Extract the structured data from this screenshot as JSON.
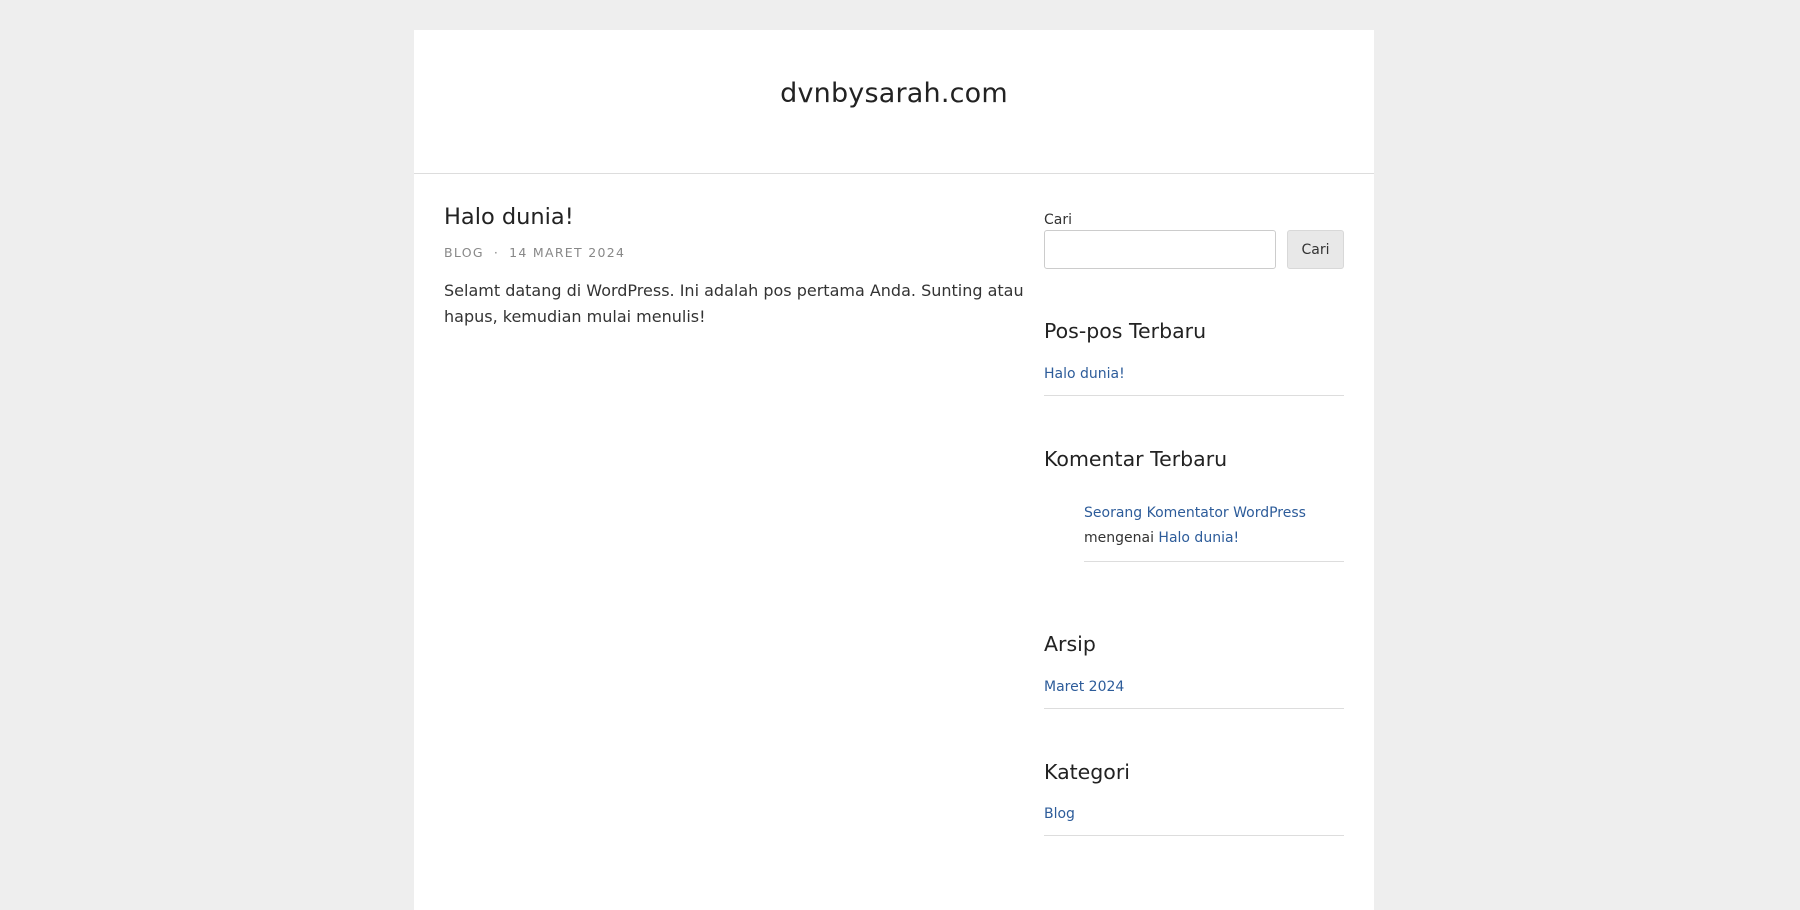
{
  "site": {
    "title": "dvnbysarah.com"
  },
  "post": {
    "title": "Halo dunia!",
    "category": "BLOG",
    "separator": "·",
    "date": "14 MARET 2024",
    "body": "Selamt datang di WordPress. Ini adalah pos pertama Anda. Sunting atau hapus, kemudian mulai menulis!"
  },
  "sidebar": {
    "search": {
      "label": "Cari",
      "value": "",
      "button_label": "Cari"
    },
    "recent_posts": {
      "title": "Pos-pos Terbaru",
      "items": [
        "Halo dunia!"
      ]
    },
    "recent_comments": {
      "title": "Komentar Terbaru",
      "items": [
        {
          "author": "Seorang Komentator WordPress",
          "connector": "mengenai",
          "post": "Halo dunia!"
        }
      ]
    },
    "archives": {
      "title": "Arsip",
      "items": [
        "Maret 2024"
      ]
    },
    "categories": {
      "title": "Kategori",
      "items": [
        "Blog"
      ]
    }
  },
  "colors": {
    "background": "#eeeeee",
    "page": "#ffffff",
    "link": "#2d5c9a",
    "meta": "#888888",
    "border": "#dddddd"
  }
}
